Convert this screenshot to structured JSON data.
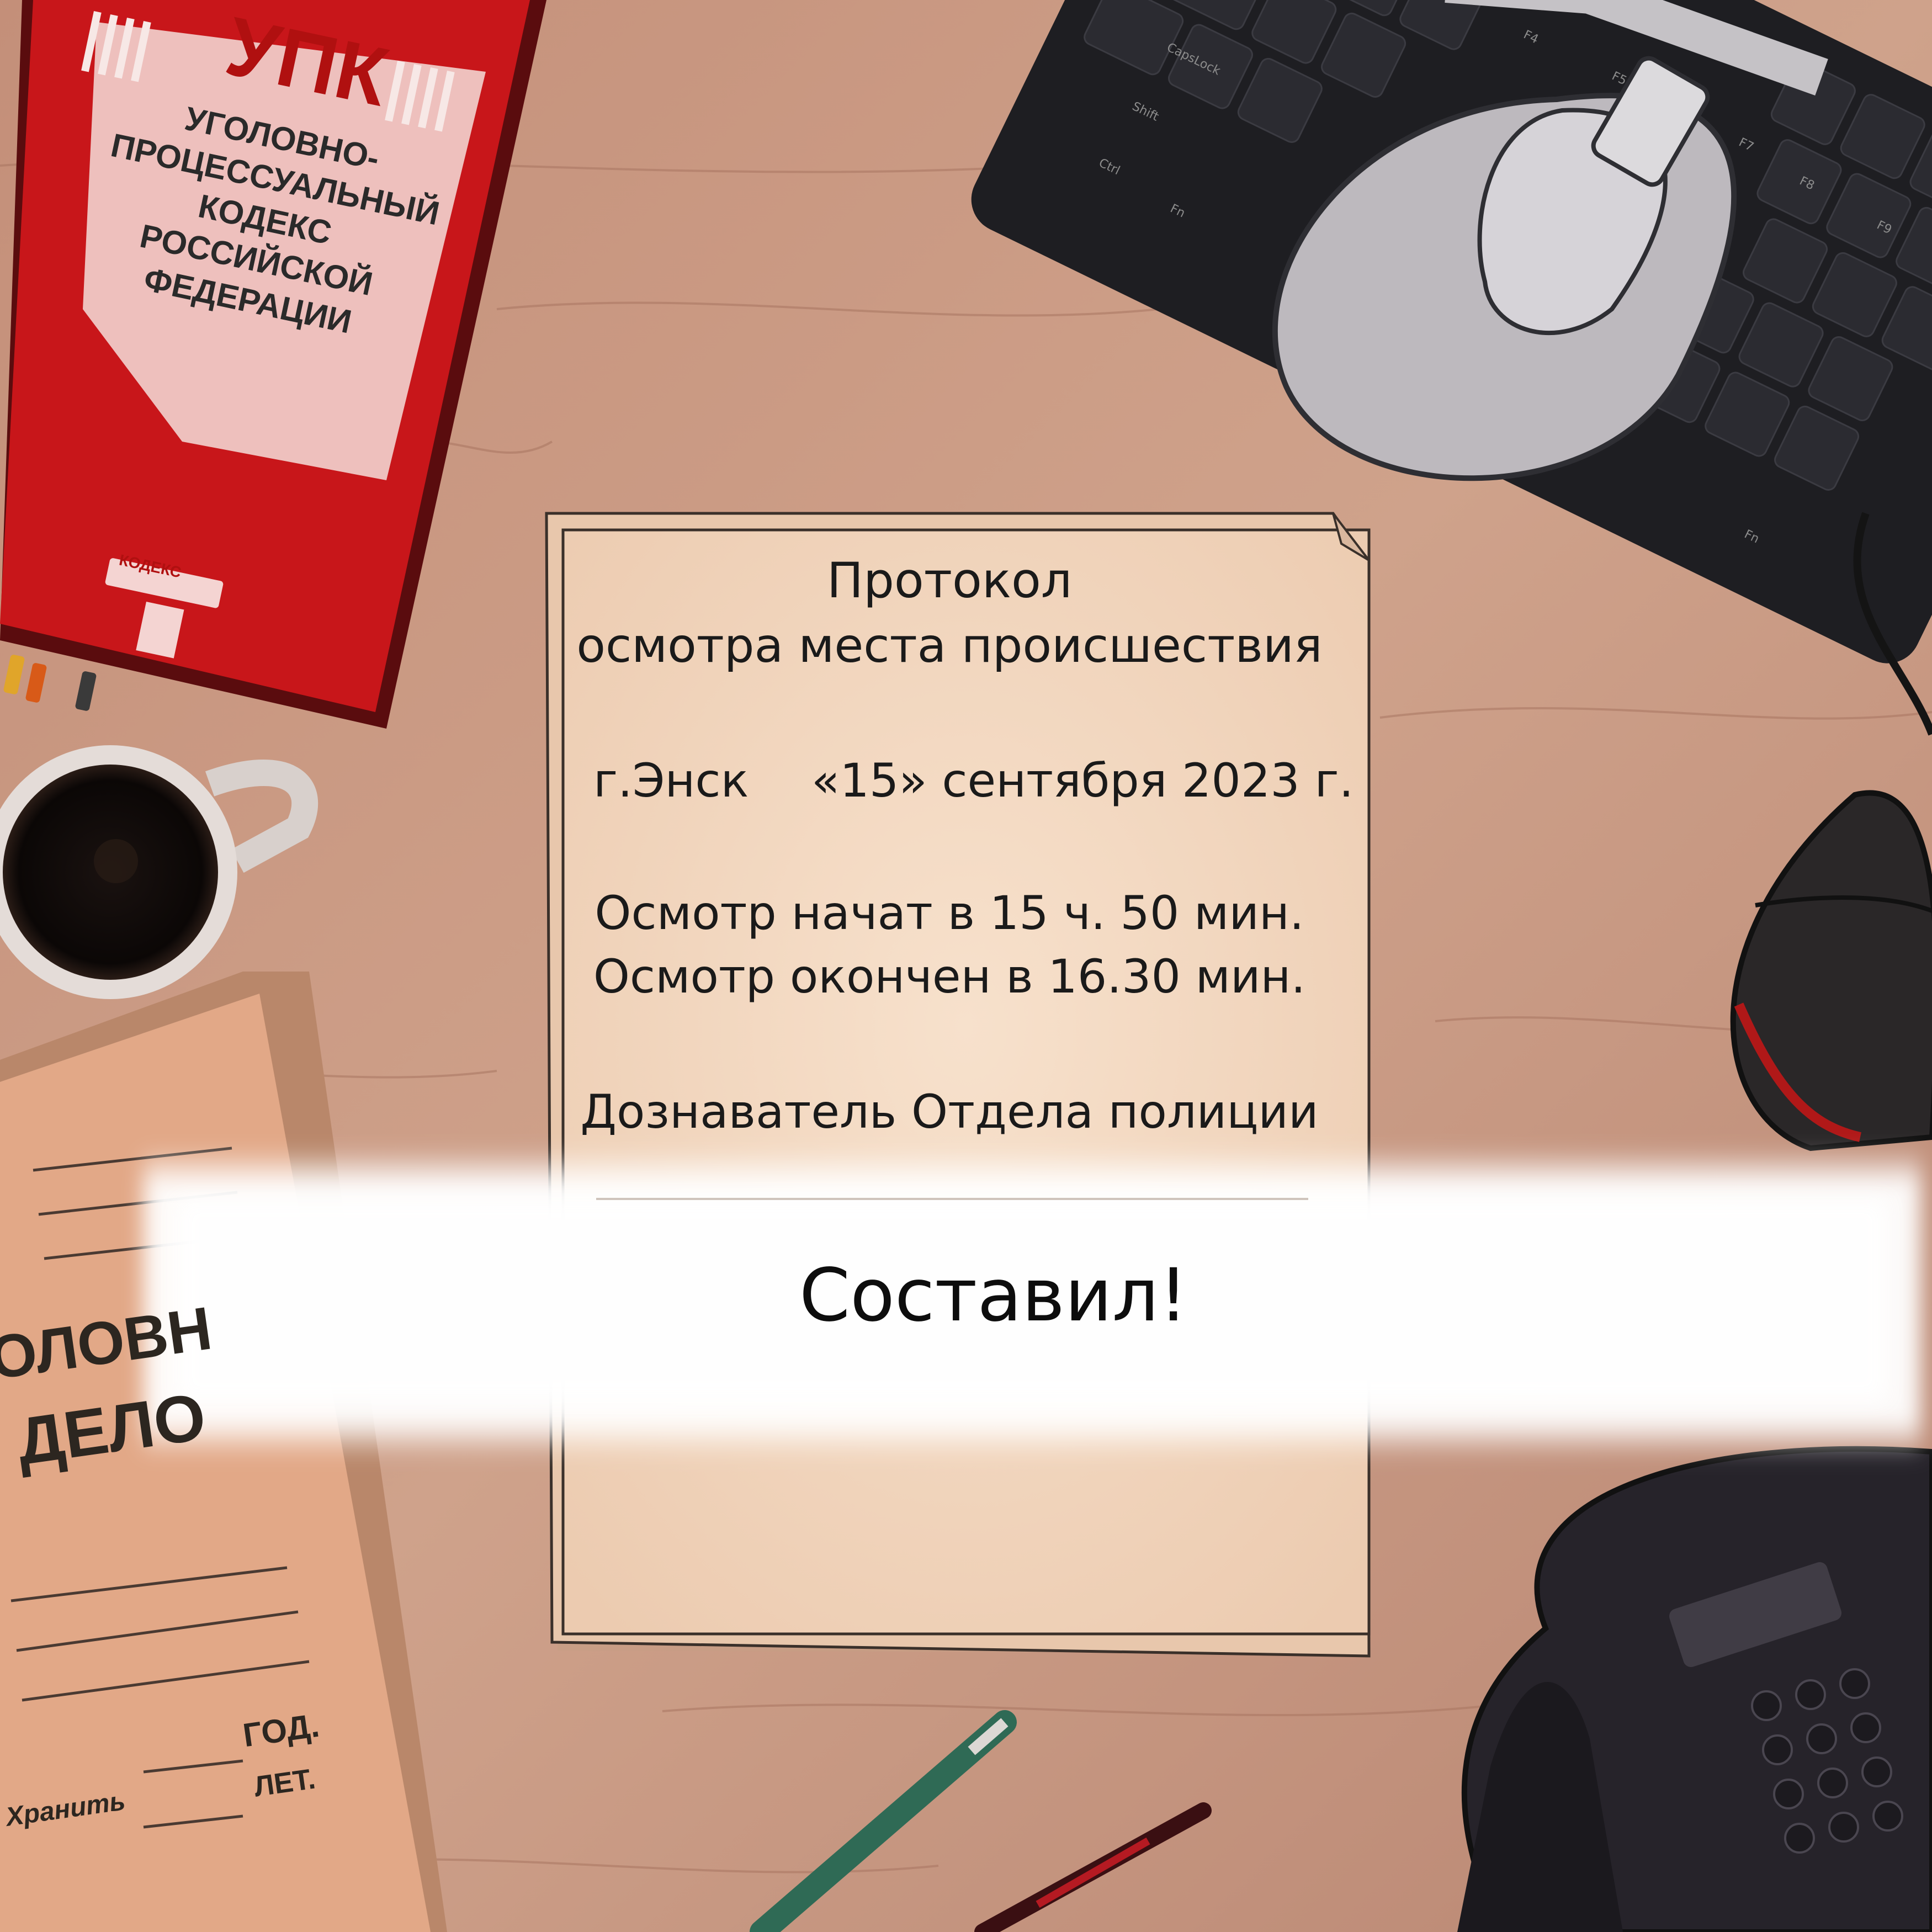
{
  "code_book": {
    "title": "УПК",
    "full_title_lines": "УГОЛОВНО-\nПРОЦЕССУАЛЬНЫЙ\nКОДЕКС\nРОССИЙСКОЙ\nФЕДЕРАЦИИ",
    "publisher": "КОДЕКС"
  },
  "protocol": {
    "title": "Протокол",
    "subtitle": "осмотра места происшествия",
    "city": "г.Энск",
    "date": "«15» сентября 2023 г.",
    "start_time": "Осмотр начат в 15 ч. 50 мин.",
    "end_time": "Осмотр окончен в 16.30 мин.",
    "investigator": "Дознаватель Отдела полиции"
  },
  "banner": {
    "text": "Составил!"
  },
  "case_folder": {
    "text_1": "ОЛОВН",
    "text_2": "ДЕЛО",
    "year_label": "ГОД.",
    "years_label": "ЛЕТ.",
    "keep_label": "Хранить"
  },
  "keyboard": {
    "keys": [
      "CapsLock",
      "Shift",
      "Ctrl",
      "Fn",
      "F4",
      "F5",
      "F7",
      "F8",
      "F9",
      "Fn"
    ]
  },
  "colors": {
    "desk": "#c99a82",
    "book_red": "#c8161a",
    "paper": "#f3d8bf",
    "folder": "#e2a887",
    "keyboard": "#1e1e22"
  }
}
